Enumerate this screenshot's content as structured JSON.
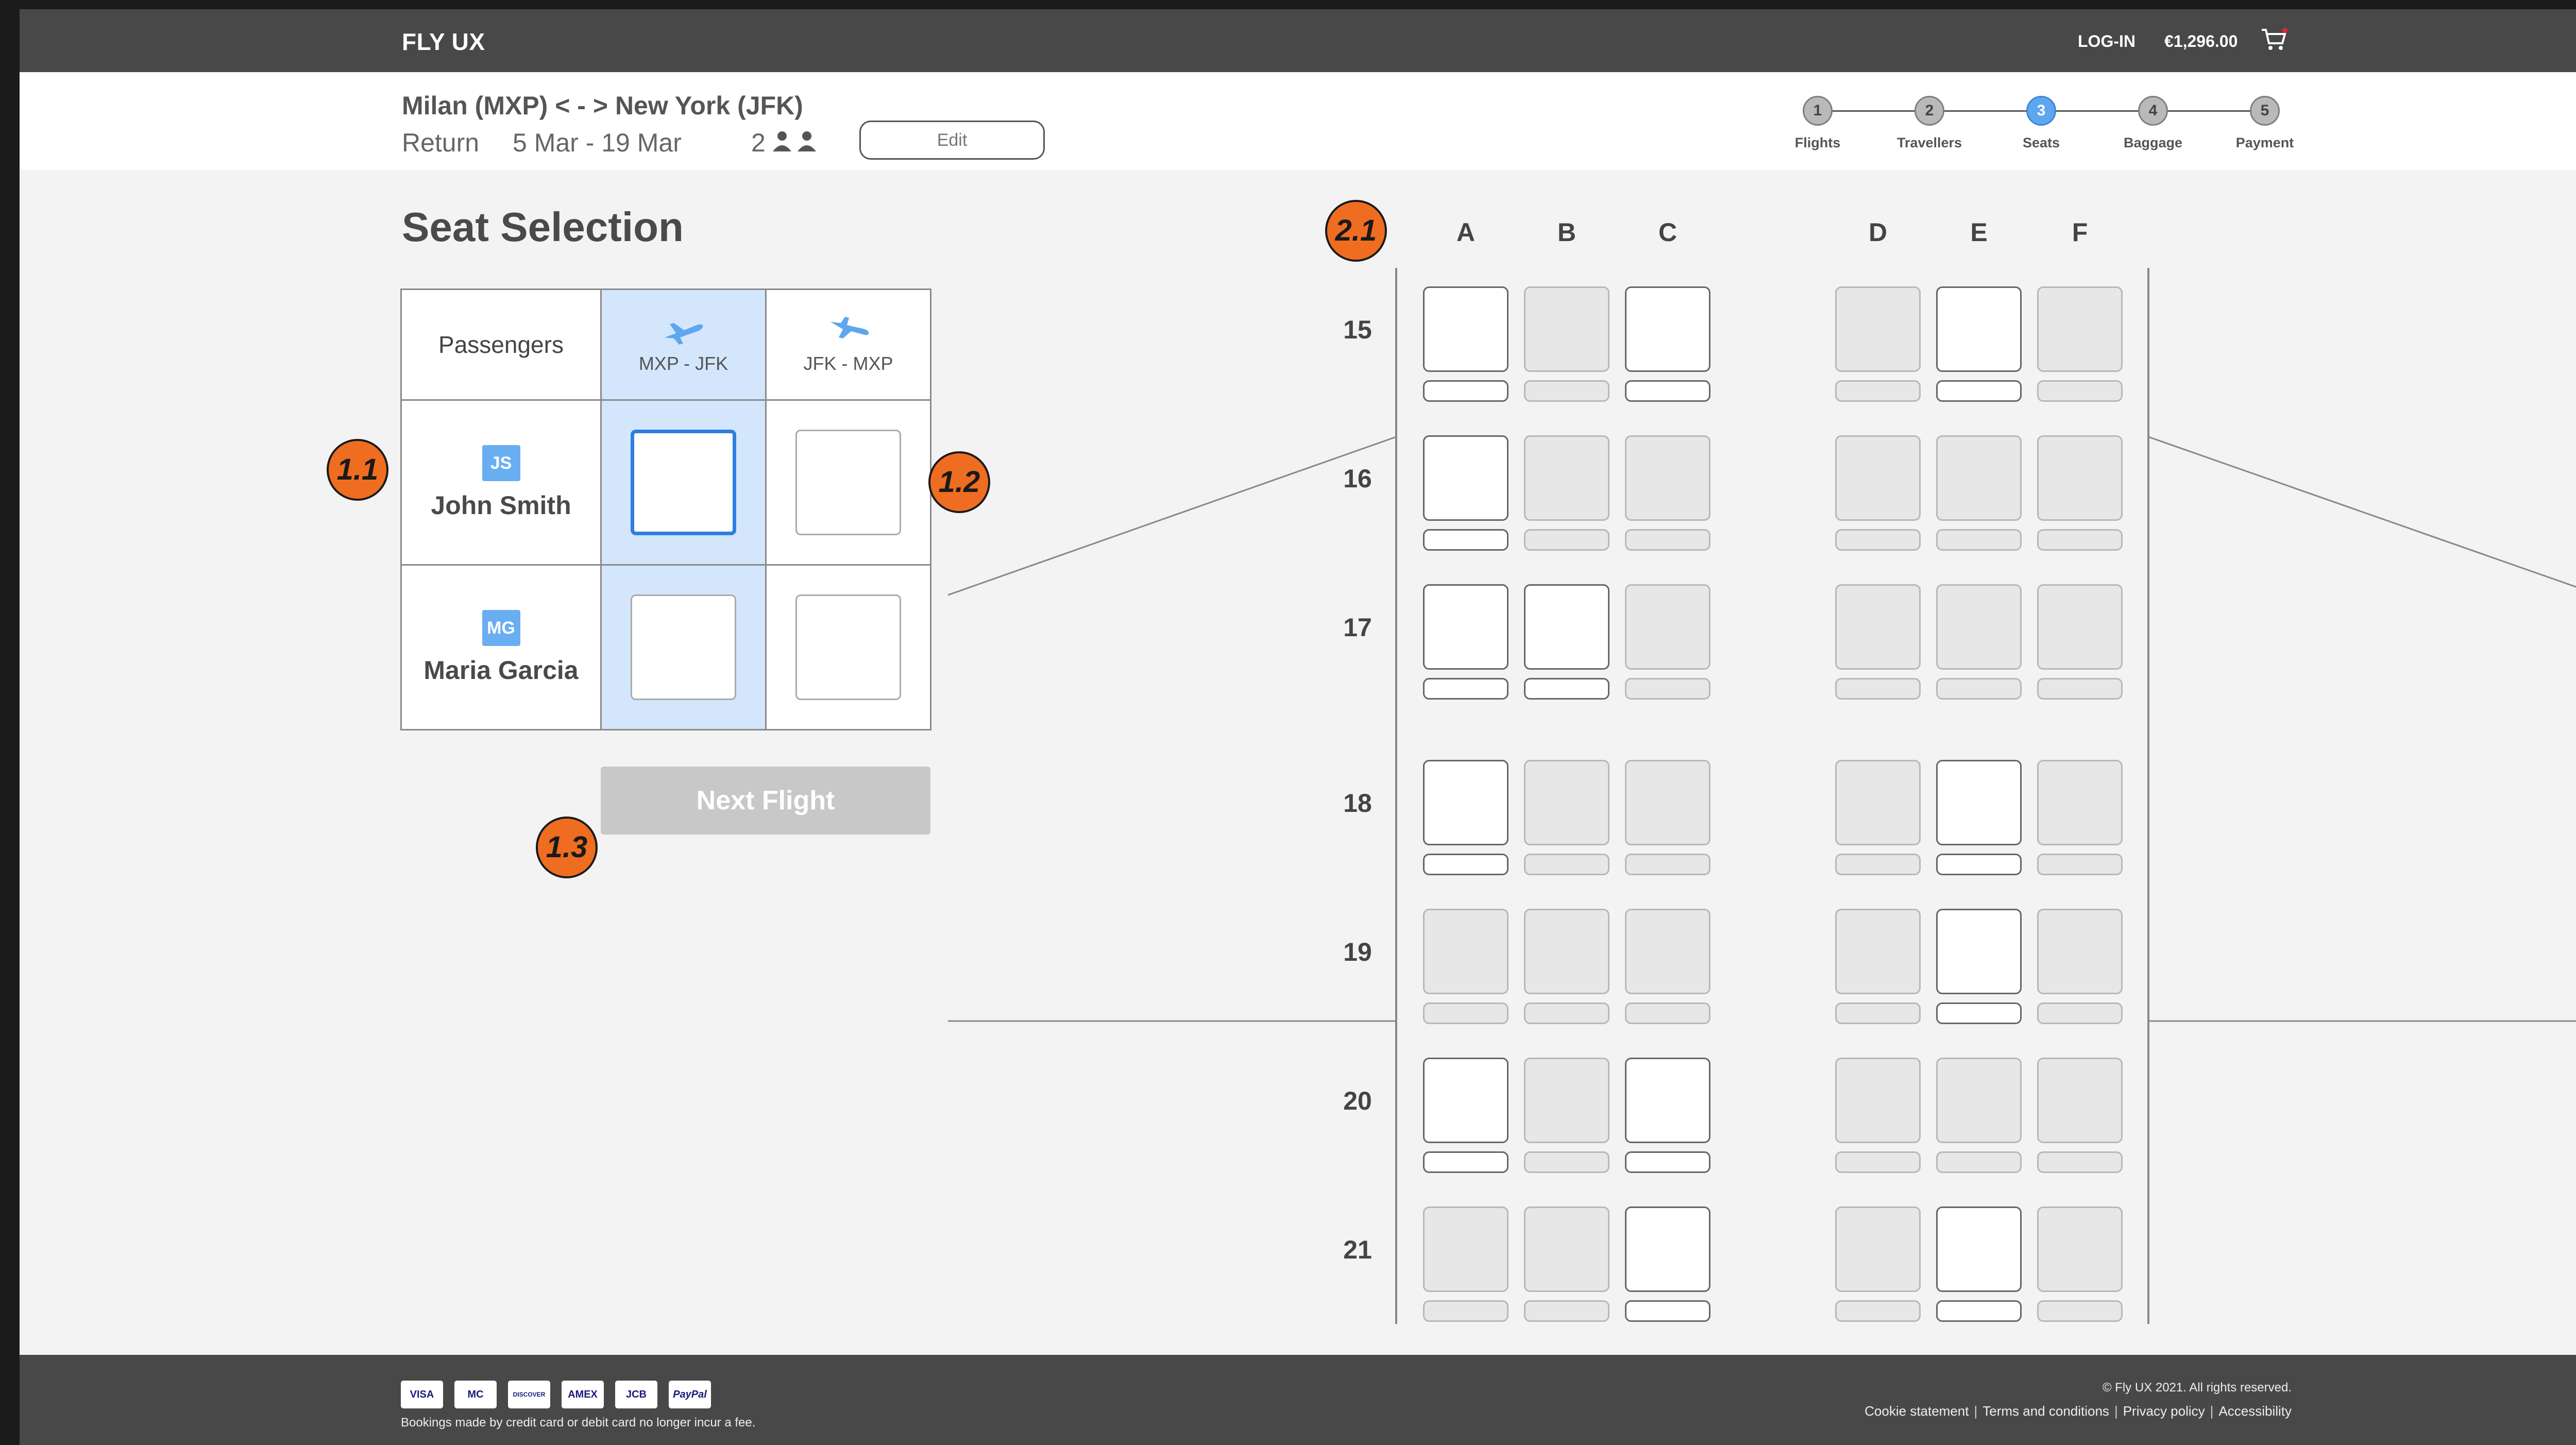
{
  "header": {
    "brand": "FLY UX",
    "login_label": "LOG-IN",
    "cart_total": "€1,296.00",
    "cart_icon": "cart-icon"
  },
  "trip": {
    "route": "Milan (MXP) < - > New York (JFK)",
    "type": "Return",
    "dates": "5 Mar - 19 Mar",
    "passengers": "2",
    "edit_label": "Edit"
  },
  "stepper": {
    "steps": [
      {
        "number": "1",
        "label": "Flights",
        "active": false
      },
      {
        "number": "2",
        "label": "Travellers",
        "active": false
      },
      {
        "number": "3",
        "label": "Seats",
        "active": true
      },
      {
        "number": "4",
        "label": "Baggage",
        "active": false
      },
      {
        "number": "5",
        "label": "Payment",
        "active": false
      }
    ]
  },
  "seat_selection": {
    "title": "Seat Selection",
    "passengers_header": "Passengers",
    "flights": [
      {
        "label": "MXP - JFK",
        "icon": "plane-takeoff-icon"
      },
      {
        "label": "JFK - MXP",
        "icon": "plane-landing-icon"
      }
    ],
    "passengers": [
      {
        "initials": "JS",
        "name": "John Smith"
      },
      {
        "initials": "MG",
        "name": "Maria Garcia"
      }
    ],
    "next_label": "Next Flight"
  },
  "callouts": {
    "c11": "1.1",
    "c12": "1.2",
    "c13": "1.3",
    "c21": "2.1"
  },
  "seat_map": {
    "columns": [
      "A",
      "B",
      "C",
      "D",
      "E",
      "F"
    ],
    "rows": [
      {
        "number": "15",
        "available": [
          true,
          false,
          true,
          false,
          true,
          false
        ]
      },
      {
        "number": "16",
        "available": [
          true,
          false,
          false,
          false,
          false,
          false
        ]
      },
      {
        "number": "17",
        "available": [
          true,
          true,
          false,
          false,
          false,
          false
        ]
      },
      {
        "number": "18",
        "available": [
          true,
          false,
          false,
          false,
          true,
          false
        ]
      },
      {
        "number": "19",
        "available": [
          false,
          false,
          false,
          false,
          true,
          false
        ]
      },
      {
        "number": "20",
        "available": [
          true,
          false,
          true,
          false,
          false,
          false
        ]
      },
      {
        "number": "21",
        "available": [
          false,
          false,
          true,
          false,
          true,
          false
        ]
      }
    ]
  },
  "footer": {
    "cards": [
      "VISA",
      "MC",
      "DISCOVER",
      "AMEX",
      "JCB",
      "PayPal"
    ],
    "note": "Bookings made by credit card or debit card no longer incur a fee.",
    "copyright": "© Fly UX 2021. All rights reserved.",
    "links": [
      "Cookie statement",
      "Terms and conditions",
      "Privacy policy",
      "Accessibility"
    ]
  },
  "colors": {
    "header_bg": "#484848",
    "accent": "#5ea7ee",
    "selected_border": "#2e7ee0",
    "callout": "#ef6d21"
  }
}
